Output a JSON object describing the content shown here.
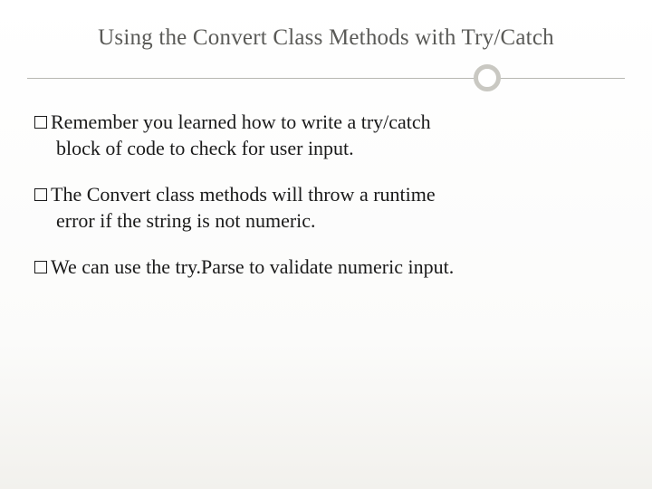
{
  "title": "Using the Convert Class Methods with Try/Catch",
  "bullets": [
    {
      "line1": "Remember you learned how to write a try/catch",
      "line2": "block of code to check for user input."
    },
    {
      "line1": "The Convert class methods will throw a runtime",
      "line2": "error if the string is not numeric."
    },
    {
      "line1": "We can use the try.Parse to validate numeric input.",
      "line2": ""
    }
  ]
}
